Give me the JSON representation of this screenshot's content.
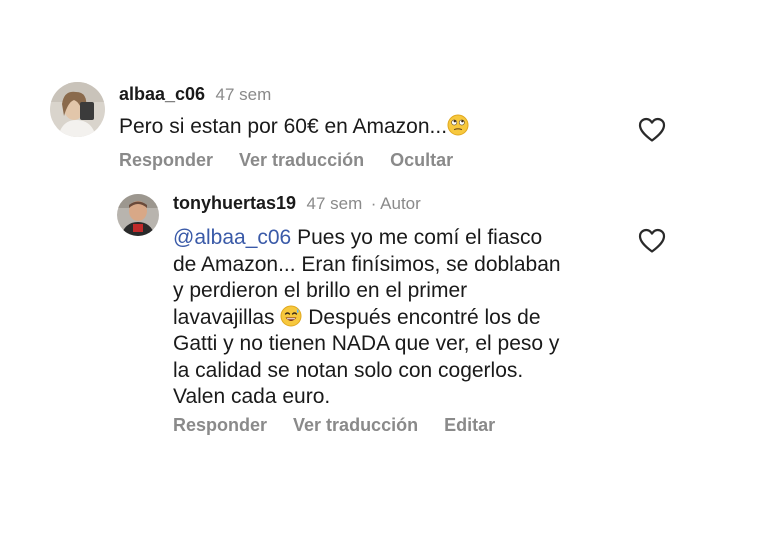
{
  "comments": [
    {
      "username": "albaa_c06",
      "time": "47 sem",
      "text_before_emoji": "Pero si estan por 60€ en Amazon...",
      "emoji_icon": "eye-roll-emoji-icon",
      "actions": [
        "Responder",
        "Ver traducción",
        "Ocultar"
      ]
    },
    {
      "username": "tonyhuertas19",
      "time": "47 sem",
      "author_badge": "· Autor",
      "mention": "@albaa_c06",
      "line1_rest": " Pues yo me comí el fiasco",
      "line2": "de Amazon... Eran finísimos, se doblaban",
      "line3": "y perdieron el brillo en el primer",
      "line4_before_emoji": "lavavajillas ",
      "emoji_icon": "sweat-smile-emoji-icon",
      "line4_after_emoji": " Después encontré los de",
      "line5": "Gatti y no tienen NADA que ver, el peso y",
      "line6": "la calidad se notan solo con cogerlos.",
      "line7": "Valen cada euro.",
      "actions": [
        "Responder",
        "Ver traducción",
        "Editar"
      ]
    }
  ],
  "colors": {
    "text": "#1a1a1a",
    "muted": "#8a8a8a",
    "mention": "#3a5aa8",
    "background": "#ffffff"
  }
}
